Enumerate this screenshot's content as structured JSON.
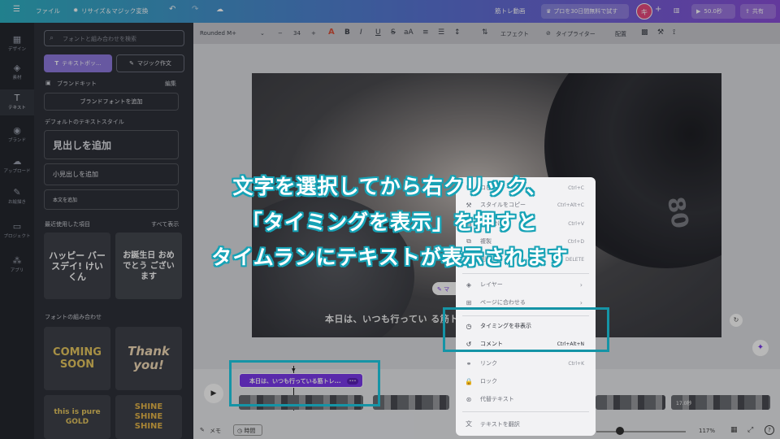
{
  "topbar": {
    "menu_icon": "hamburger-icon",
    "file": "ファイル",
    "resize": "リサイズ＆マジック変換",
    "doc_title": "筋トレ動画",
    "trial": "プロを30日間無料で試す",
    "avatar": "キ",
    "plus": "+",
    "play_time": "50.0秒",
    "share": "共有"
  },
  "rail": {
    "items": [
      {
        "icon": "design-icon",
        "label": "デザイン"
      },
      {
        "icon": "elements-icon",
        "label": "素材"
      },
      {
        "icon": "text-icon",
        "label": "テキスト"
      },
      {
        "icon": "brand-icon",
        "label": "ブランド"
      },
      {
        "icon": "upload-icon",
        "label": "アップロード"
      },
      {
        "icon": "draw-icon",
        "label": "お絵描き"
      },
      {
        "icon": "projects-icon",
        "label": "プロジェクト"
      },
      {
        "icon": "apps-icon",
        "label": "アプリ"
      }
    ]
  },
  "panel": {
    "search_placeholder": "フォントと組み合わせを検索",
    "add_textbox": "テキストボッ...",
    "magic_write": "マジック作文",
    "brand_kit": "ブランドキット",
    "edit": "編集",
    "add_brand_font": "ブランドフォントを追加",
    "default_styles": "デフォルトのテキストスタイル",
    "heading": "見出しを追加",
    "subheading": "小見出しを追加",
    "body": "本文を追加",
    "recent": "最近使用した項目",
    "show_all": "すべて表示",
    "recent_items": [
      "ハッピー バースデイ! けいくん",
      "お誕生日 おめでとう ございます"
    ],
    "combos": "フォントの組み合わせ",
    "combo_items": [
      "COMING SOON",
      "Thank you!",
      "this is pure GOLD",
      "SHINE SHINE SHINE"
    ]
  },
  "toolbar": {
    "font": "Rounded M+",
    "size": "34",
    "effects": "エフェクト",
    "typewriter": "タイプライター",
    "position": "配置"
  },
  "canvas": {
    "caption": "本日は、いつも行ってい る筋トレジムを紹介します。",
    "magic_chip": "マ"
  },
  "context_menu": {
    "items": [
      {
        "icon": "copy-icon",
        "label": "コピー",
        "shortcut": "Ctrl+C"
      },
      {
        "icon": "copy-style-icon",
        "label": "スタイルをコピー",
        "shortcut": "Ctrl+Alt+C"
      },
      {
        "icon": "paste-icon",
        "label": "貼り付け",
        "shortcut": "Ctrl+V"
      },
      {
        "icon": "duplicate-icon",
        "label": "複製",
        "shortcut": "Ctrl+D"
      },
      {
        "icon": "delete-icon",
        "label": "削除",
        "shortcut": "DELETE"
      },
      {
        "icon": "layer-icon",
        "label": "レイヤー",
        "shortcut": ""
      },
      {
        "icon": "align-page-icon",
        "label": "ページに合わせる",
        "shortcut": ""
      },
      {
        "icon": "clock-icon",
        "label": "タイミングを非表示",
        "shortcut": ""
      },
      {
        "icon": "comment-icon",
        "label": "コメント",
        "shortcut": "Ctrl+Alt+N"
      },
      {
        "icon": "link-icon",
        "label": "リンク",
        "shortcut": "Ctrl+K"
      },
      {
        "icon": "lock-icon",
        "label": "ロック",
        "shortcut": ""
      },
      {
        "icon": "alt-text-icon",
        "label": "代替テキスト",
        "shortcut": ""
      },
      {
        "icon": "translate-icon",
        "label": "テキストを翻訳",
        "shortcut": ""
      }
    ]
  },
  "timeline": {
    "text_clip": "本日は、いつも行っている筋トレ...",
    "clip_more": "•••",
    "notes": "メモ",
    "time": "時間",
    "zoom": "117%",
    "clip_duration": "17.0秒"
  },
  "overlay": {
    "lines": [
      "文字を選択してから右クリック、",
      "「タイミングを表示」を押すと",
      "タイムランにテキストが表示されます"
    ]
  },
  "colors": {
    "accent": "#1594a6",
    "purple": "#7c3aed"
  }
}
